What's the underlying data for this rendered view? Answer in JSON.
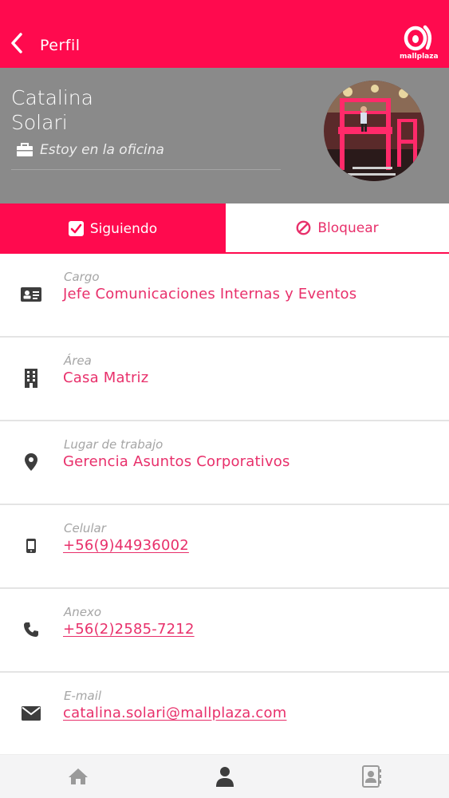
{
  "header": {
    "title": "Perfil",
    "brand": "mallplaza",
    "brand_color": "#ff0a4e"
  },
  "profile": {
    "first_name": "Catalina",
    "last_name": "Solari",
    "status": "Estoy en la oficina",
    "status_icon": "briefcase-icon"
  },
  "actions": {
    "follow_label": "Siguiendo",
    "block_label": "Bloquear"
  },
  "details": [
    {
      "label": "Cargo",
      "value": "Jefe Comunicaciones Internas y Eventos",
      "icon": "id-card-icon"
    },
    {
      "label": "Área",
      "value": "Casa Matriz",
      "icon": "building-icon"
    },
    {
      "label": "Lugar de trabajo",
      "value": "Gerencia Asuntos Corporativos",
      "icon": "location-pin-icon"
    },
    {
      "label": "Celular",
      "value": "+56(9)44936002",
      "icon": "mobile-phone-icon"
    },
    {
      "label": "Anexo",
      "value": "+56(2)2585-7212",
      "icon": "phone-icon"
    },
    {
      "label": "E-mail",
      "value": "catalina.solari@mallplaza.com",
      "icon": "envelope-icon"
    }
  ],
  "tabbar": {
    "items": [
      "home-icon",
      "user-icon",
      "contacts-icon"
    ],
    "active": "user-icon"
  }
}
